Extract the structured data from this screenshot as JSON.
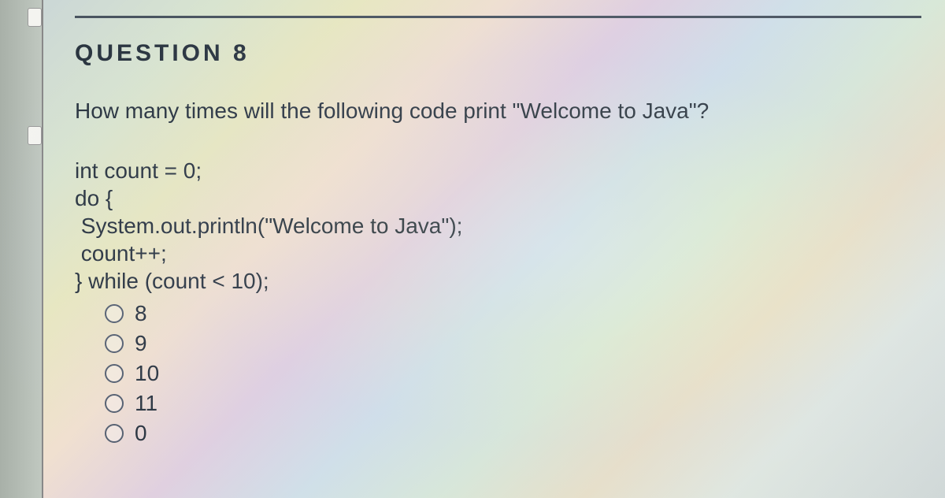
{
  "header": "QUESTION 8",
  "question": "How many times will the following code print \"Welcome to Java\"?",
  "code": {
    "line1": "int count = 0;",
    "line2": "do {",
    "line3": " System.out.println(\"Welcome to Java\");",
    "line4": " count++;",
    "line5": "} while (count < 10);"
  },
  "options": {
    "a": "8",
    "b": "9",
    "c": "10",
    "d": "11",
    "e": "0"
  }
}
